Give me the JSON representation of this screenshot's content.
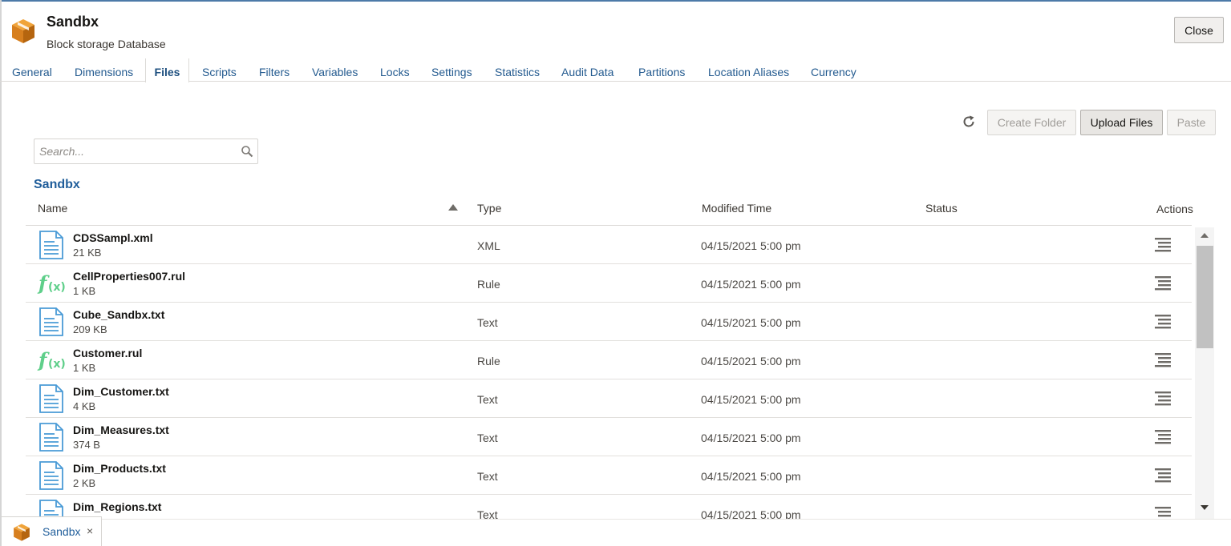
{
  "header": {
    "title": "Sandbx",
    "subtitle": "Block storage Database",
    "close_label": "Close",
    "icon": "cube-icon",
    "accent_color": "#d77f1e"
  },
  "tabs": [
    {
      "label": "General"
    },
    {
      "label": "Dimensions"
    },
    {
      "label": "Files",
      "active": true
    },
    {
      "label": "Scripts"
    },
    {
      "label": "Filters"
    },
    {
      "label": "Variables"
    },
    {
      "label": "Locks"
    },
    {
      "label": "Settings"
    },
    {
      "label": "Statistics"
    },
    {
      "label": "Audit Data"
    },
    {
      "label": "Partitions"
    },
    {
      "label": "Location Aliases"
    },
    {
      "label": "Currency"
    }
  ],
  "toolbar": {
    "refresh_icon": "refresh-icon",
    "create_folder_label": "Create Folder",
    "upload_files_label": "Upload Files",
    "paste_label": "Paste"
  },
  "search": {
    "placeholder": "Search...",
    "value": ""
  },
  "folder": {
    "title": "Sandbx"
  },
  "columns": {
    "name": "Name",
    "type": "Type",
    "modified": "Modified Time",
    "status": "Status",
    "actions": "Actions"
  },
  "files": [
    {
      "name": "CDSSampl.xml",
      "size": "21 KB",
      "type": "XML",
      "modified": "04/15/2021 5:00 pm",
      "status": "",
      "icon": "document-icon"
    },
    {
      "name": "CellProperties007.rul",
      "size": "1 KB",
      "type": "Rule",
      "modified": "04/15/2021 5:00 pm",
      "status": "",
      "icon": "function-icon"
    },
    {
      "name": "Cube_Sandbx.txt",
      "size": "209 KB",
      "type": "Text",
      "modified": "04/15/2021 5:00 pm",
      "status": "",
      "icon": "document-icon"
    },
    {
      "name": "Customer.rul",
      "size": "1 KB",
      "type": "Rule",
      "modified": "04/15/2021 5:00 pm",
      "status": "",
      "icon": "function-icon"
    },
    {
      "name": "Dim_Customer.txt",
      "size": "4 KB",
      "type": "Text",
      "modified": "04/15/2021 5:00 pm",
      "status": "",
      "icon": "document-icon"
    },
    {
      "name": "Dim_Measures.txt",
      "size": "374 B",
      "type": "Text",
      "modified": "04/15/2021 5:00 pm",
      "status": "",
      "icon": "document-icon"
    },
    {
      "name": "Dim_Products.txt",
      "size": "2 KB",
      "type": "Text",
      "modified": "04/15/2021 5:00 pm",
      "status": "",
      "icon": "document-icon"
    },
    {
      "name": "Dim_Regions.txt",
      "size": "",
      "type": "Text",
      "modified": "04/15/2021 5:00 pm",
      "status": "",
      "icon": "document-icon"
    }
  ],
  "bottom_tab": {
    "label": "Sandbx",
    "close_glyph": "×"
  }
}
